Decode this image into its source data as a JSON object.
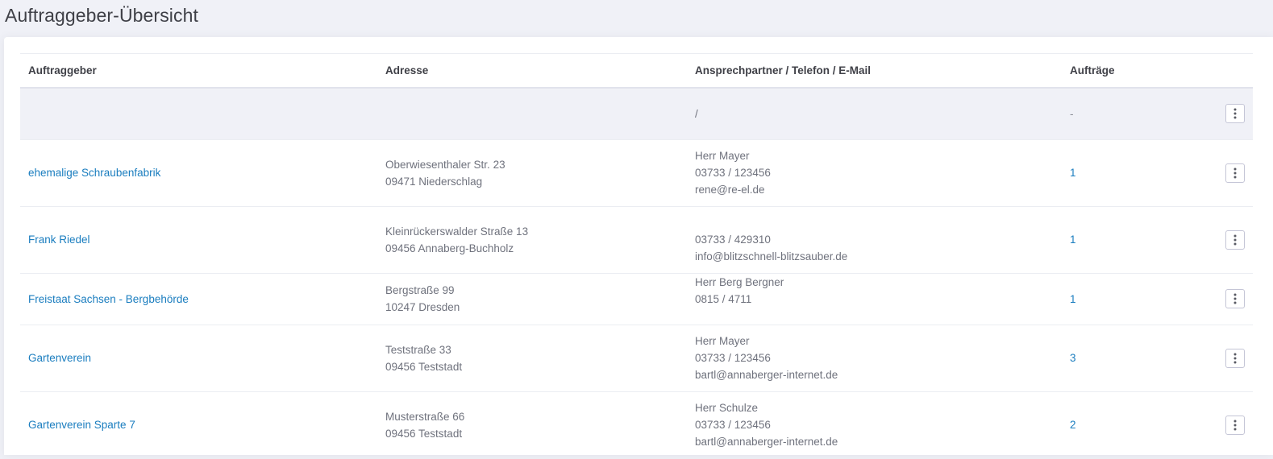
{
  "page": {
    "title": "Auftraggeber-Übersicht"
  },
  "table": {
    "headers": {
      "client": "Auftraggeber",
      "address": "Adresse",
      "contact": "Ansprechpartner / Telefon / E-Mail",
      "orders": "Aufträge"
    },
    "rows": [
      {
        "name": "",
        "street": "",
        "city": "",
        "contact_person": "",
        "phone": "/",
        "email": "",
        "orders": "-",
        "highlighted": true
      },
      {
        "name": "ehemalige Schraubenfabrik",
        "street": "Oberwiesenthaler Str. 23",
        "city": "09471 Niederschlag",
        "contact_person": "Herr Mayer",
        "phone": "03733 / 123456",
        "email": "rene@re-el.de",
        "orders": "1"
      },
      {
        "name": "Frank Riedel",
        "street": "Kleinrückerswalder Straße 13",
        "city": "09456 Annaberg-Buchholz",
        "contact_person": "",
        "phone": "03733 / 429310",
        "email": "info@blitzschnell-blitzsauber.de",
        "orders": "1"
      },
      {
        "name": "Freistaat Sachsen - Bergbehörde",
        "street": "Bergstraße 99",
        "city": "10247 Dresden",
        "contact_person": "Herr Berg Bergner",
        "phone": "0815 / 4711",
        "email": "",
        "orders": "1"
      },
      {
        "name": "Gartenverein",
        "street": "Teststraße 33",
        "city": "09456 Teststadt",
        "contact_person": "Herr Mayer",
        "phone": "03733 / 123456",
        "email": "bartl@annaberger-internet.de",
        "orders": "3"
      },
      {
        "name": "Gartenverein Sparte 7",
        "street": "Musterstraße 66",
        "city": "09456 Teststadt",
        "contact_person": "Herr Schulze",
        "phone": "03733 / 123456",
        "email": "bartl@annaberger-internet.de",
        "orders": "2"
      }
    ]
  },
  "colors": {
    "link": "#1a7dbf",
    "page_background": "#f0f1f7",
    "panel_background": "#ffffff"
  },
  "icons": {
    "row_menu": "vertical-dots-icon"
  }
}
